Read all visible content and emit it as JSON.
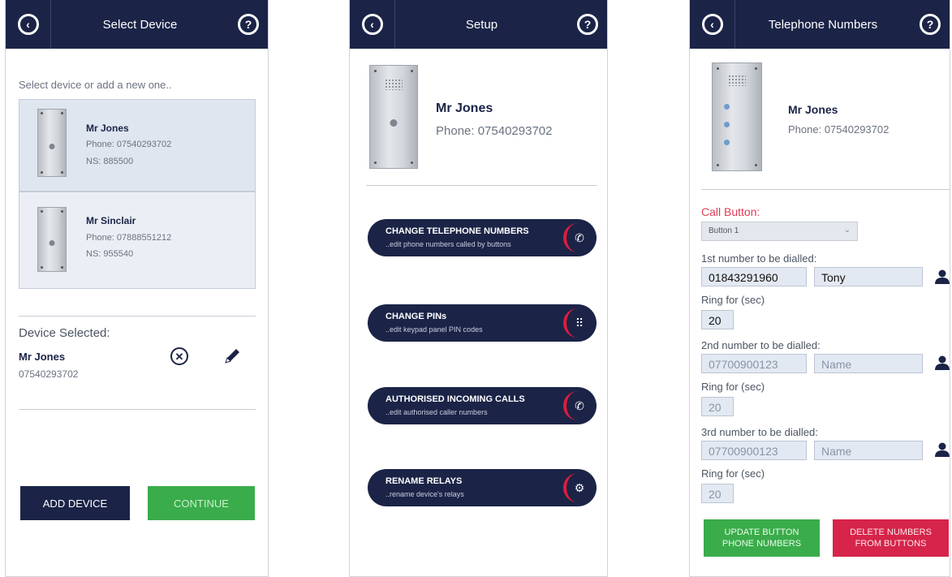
{
  "select_screen": {
    "title": "Select Device",
    "prompt": "Select device or add a new one..",
    "devices": [
      {
        "name": "Mr Jones",
        "phone": "Phone: 07540293702",
        "ns": "NS: 885500"
      },
      {
        "name": "Mr Sinclair",
        "phone": "Phone: 07888551212",
        "ns": "NS: 955540"
      }
    ],
    "selected_label": "Device Selected:",
    "selected_name": "Mr Jones",
    "selected_phone": "07540293702",
    "add_label": "ADD DEVICE",
    "continue_label": "CONTINUE"
  },
  "setup_screen": {
    "title": "Setup",
    "name": "Mr Jones",
    "phone": "Phone: 07540293702",
    "menu": [
      {
        "title": "CHANGE TELEPHONE NUMBERS",
        "subtitle": "..edit phone numbers called by buttons",
        "icon": "phone-forward-icon"
      },
      {
        "title": "CHANGE PINs",
        "subtitle": "..edit keypad panel PIN codes",
        "icon": "keypad-icon"
      },
      {
        "title": "AUTHORISED INCOMING CALLS",
        "subtitle": "..edit authorised caller numbers",
        "icon": "phone-incoming-icon"
      },
      {
        "title": "RENAME RELAYS",
        "subtitle": "..rename device's relays",
        "icon": "relay-icon"
      }
    ]
  },
  "phone_screen": {
    "title": "Telephone Numbers",
    "name": "Mr Jones",
    "phone": "Phone: 07540293702",
    "call_button_label": "Call Button:",
    "call_button_value": "Button 1",
    "entries": [
      {
        "label": "1st number to be dialled:",
        "number": "01843291960",
        "name": "Tony",
        "ring_label": "Ring for (sec)",
        "ring": "20"
      },
      {
        "label": "2nd number to be dialled:",
        "number": "07700900123",
        "name": "Name",
        "ring_label": "Ring for (sec)",
        "ring": "20"
      },
      {
        "label": "3rd number to be dialled:",
        "number": "07700900123",
        "name": "Name",
        "ring_label": "Ring for (sec)",
        "ring": "20"
      }
    ],
    "update_label_1": "UPDATE BUTTON",
    "update_label_2": "PHONE NUMBERS",
    "delete_label_1": "DELETE NUMBERS",
    "delete_label_2": "FROM BUTTONS"
  },
  "colors": {
    "navy": "#1b2447",
    "green": "#3aac4b",
    "red": "#d6244a",
    "accent_red": "#e21c3b"
  }
}
